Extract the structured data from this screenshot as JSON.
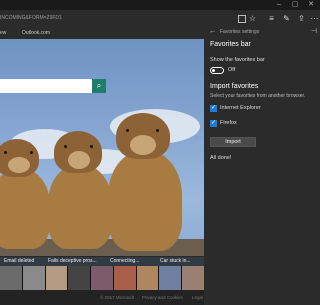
{
  "browser": {
    "address_text": "INCOMING&FORM=Z9FD1",
    "favorite_link": "ew",
    "favorite_outlook": "Outlook.com"
  },
  "page": {
    "news_titles": [
      "Email deleted",
      "Fails deceptive pros...",
      "Connecting...",
      "Car stuck in..."
    ],
    "footer_links": [
      "© 2017 Microsoft",
      "Privacy and Cookies",
      "Legal"
    ]
  },
  "settings": {
    "caption": "Favorites settings",
    "title": "Favorites bar",
    "show_label": "Show the favorites bar",
    "toggle_state": "Off",
    "import_title": "Import favorites",
    "import_hint": "Select your favorites from another browser.",
    "browsers": [
      {
        "label": "Internet Explorer",
        "checked": "✓"
      },
      {
        "label": "Firefox",
        "checked": "✓"
      }
    ],
    "import_button": "Import",
    "status": "All done!"
  },
  "colors": {
    "accent": "#1f7ae0",
    "search_green": "#1d7f6a",
    "panel_bg": "#2b2b2b"
  },
  "icons": {
    "search": "search-icon",
    "favorite": "star-icon",
    "hub": "hub-icon",
    "note": "web-note-icon",
    "share": "share-icon",
    "more": "more-icon",
    "back": "back-icon",
    "pin": "pin-icon"
  }
}
